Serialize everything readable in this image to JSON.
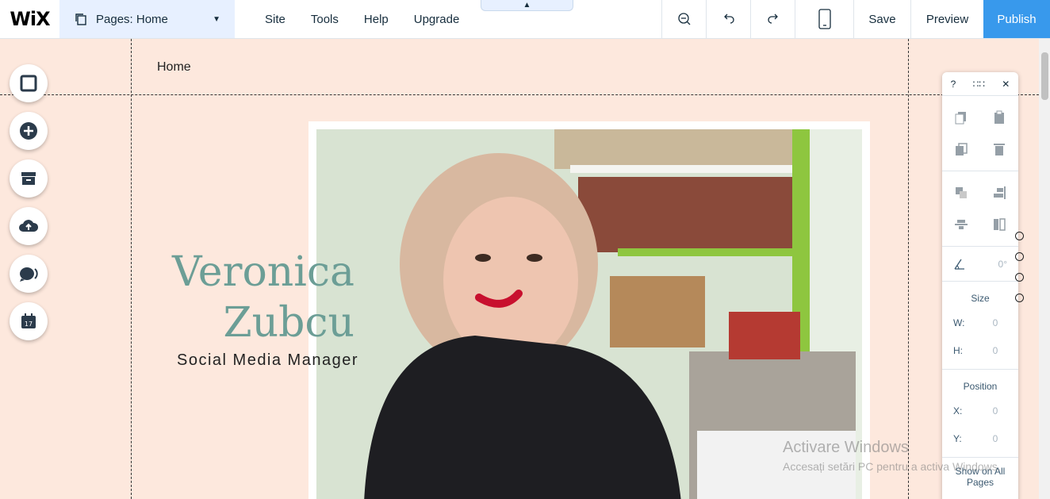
{
  "topbar": {
    "logo": "WiX",
    "pages_label": "Pages: Home",
    "menu": [
      "Site",
      "Tools",
      "Help",
      "Upgrade"
    ],
    "save": "Save",
    "preview": "Preview",
    "publish": "Publish",
    "publish_color": "#3899ec"
  },
  "canvas": {
    "page_name": "Home",
    "hero": {
      "name_line1": "Veronica",
      "name_line2": "Zubcu",
      "role": "Social Media Manager",
      "name_color": "#6c9e96",
      "background": "#fde8dd"
    }
  },
  "left_tools": [
    "background-icon",
    "add-icon",
    "store-icon",
    "upload-icon",
    "chat-icon",
    "calendar-icon"
  ],
  "panel": {
    "help": "?",
    "rotate_value": "0°",
    "size_title": "Size",
    "w_label": "W:",
    "w_value": "0",
    "h_label": "H:",
    "h_value": "0",
    "position_title": "Position",
    "x_label": "X:",
    "x_value": "0",
    "y_label": "Y:",
    "y_value": "0",
    "show_all": "Show on All Pages"
  },
  "watermark": {
    "line1": "Activare Windows",
    "line2": "Accesați setări PC pentru a activa Windows."
  }
}
